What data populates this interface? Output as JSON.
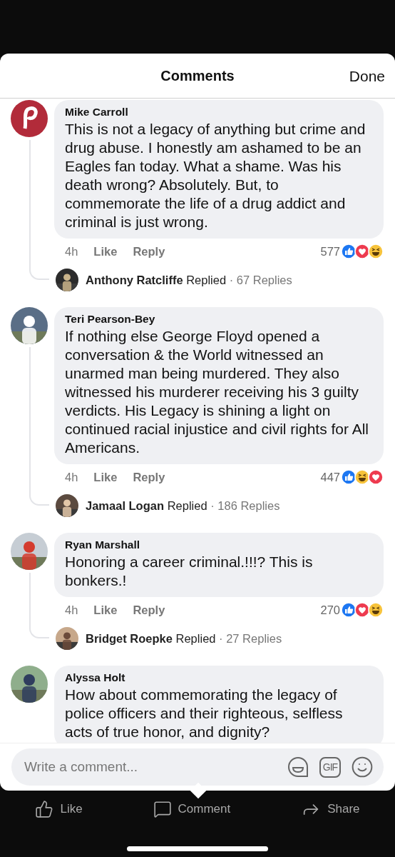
{
  "header": {
    "title": "Comments",
    "done": "Done"
  },
  "comments": [
    {
      "author": "Mike Carroll",
      "text": "This is not a legacy of anything but crime and drug abuse.  I honestly am ashamed to be an Eagles fan today. What a shame. Was his death wrong? Absolutely.  But, to commemorate the life of a drug addict and criminal is just wrong.",
      "time": "4h",
      "like": "Like",
      "reply": "Reply",
      "count": "577",
      "reactions": [
        {
          "kind": "like"
        },
        {
          "kind": "love"
        },
        {
          "kind": "haha"
        }
      ],
      "replier": "Anthony Ratcliffe",
      "replied": "Replied",
      "replies": "· 67 Replies"
    },
    {
      "author": "Teri Pearson-Bey",
      "text": "If nothing else George Floyd opened a conversation & the World witnessed an unarmed man being murdered. They also witnessed his murderer receiving his 3 guilty verdicts. His Legacy is  shining a light on continued racial injustice and civil rights for All Americans.",
      "time": "4h",
      "like": "Like",
      "reply": "Reply",
      "count": "447",
      "reactions": [
        {
          "kind": "like"
        },
        {
          "kind": "haha"
        },
        {
          "kind": "love"
        }
      ],
      "replier": "Jamaal Logan",
      "replied": "Replied",
      "replies": "· 186 Replies"
    },
    {
      "author": "Ryan Marshall",
      "text": "Honoring a career criminal.!!!? This is bonkers.!",
      "time": "4h",
      "like": "Like",
      "reply": "Reply",
      "count": "270",
      "reactions": [
        {
          "kind": "like"
        },
        {
          "kind": "love"
        },
        {
          "kind": "haha"
        }
      ],
      "replier": "Bridget Roepke",
      "replied": "Replied",
      "replies": "· 27 Replies"
    },
    {
      "author": "Alyssa Holt",
      "text": "How about commemorating the legacy of police officers and their righteous, selfless acts of true honor, and dignity?"
    }
  ],
  "composer": {
    "placeholder": "Write a comment...",
    "gif": "GIF"
  },
  "actions": [
    {
      "kind": "like",
      "label": "Like"
    },
    {
      "kind": "comment",
      "label": "Comment"
    },
    {
      "kind": "share",
      "label": "Share"
    }
  ]
}
